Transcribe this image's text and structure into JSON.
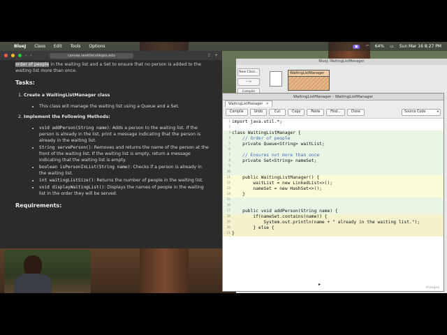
{
  "menubar": {
    "app_name": "BlueJ",
    "items": [
      "Class",
      "Edit",
      "Tools",
      "Options"
    ],
    "battery": "64%",
    "clock": "Sun Mar 16  8:27 PM"
  },
  "browser": {
    "url": "canvas.seattlecolleges.edu",
    "intro_highlight": "order of people",
    "intro_text": " in the waiting list and a Set to ensure that no person is added to the waiting list more than once.",
    "tasks_heading": "Tasks:",
    "task1_title": "Create a WaitingListManager class",
    "task1_bullet": "This class will manage the waiting list using a Queue and a Set.",
    "task2_title": "Implement the Following Methods:",
    "methods": [
      {
        "sig": "void addPerson(String name)",
        "desc": ": Adds a person to the waiting list. If the person is already in the list, print a message indicating that the person is already in the waiting list."
      },
      {
        "sig": "String servePerson()",
        "desc": ": Removes and returns the name of the person at the front of the waiting list. If the waiting list is empty, return a message indicating that the waiting list is empty."
      },
      {
        "sig": "boolean isPersonInList(String name)",
        "desc": ": Checks if a person is already in the waiting list."
      },
      {
        "sig": "int waitingListSize()",
        "desc": ": Returns the number of people in the waiting list."
      },
      {
        "sig": "void displayWaitingList()",
        "desc": ": Displays the names of people in the waiting list in the order they will be served."
      }
    ],
    "requirements_heading": "Requirements:"
  },
  "bluej": {
    "title": "BlueJ: WaitingListManager",
    "new_class": "New Class...",
    "arrow": "--->",
    "compile": "Compile",
    "class_name": "WaitingListManager"
  },
  "editor": {
    "title": "WaitingListManager - WaitingListManager",
    "tab": "WaitingListManager",
    "tab_close": "✕",
    "buttons": [
      "Compile",
      "Undo",
      "Cut",
      "Copy",
      "Paste",
      "Find...",
      "Close"
    ],
    "source_select": "Source Code",
    "status": "changed",
    "lines": [
      "import java.util.*;",
      "",
      "class WaitingListManager {",
      "    // Order of people",
      "    private Queue<String> waitList;",
      "",
      "    // Ensures not more than once",
      "    private Set<String> nameSet;",
      "",
      "",
      "    public WaitingListManager() {",
      "        waitList = new LinkedList<>();",
      "        nameSet = new HashSet<>();",
      "    }",
      "",
      "",
      "    public void addPerson(String name) {",
      "        if(nameSet.contains(name)) {",
      "            System.out.println(name + \" already in the waiting list.\");",
      "        } else {",
      "}"
    ]
  }
}
